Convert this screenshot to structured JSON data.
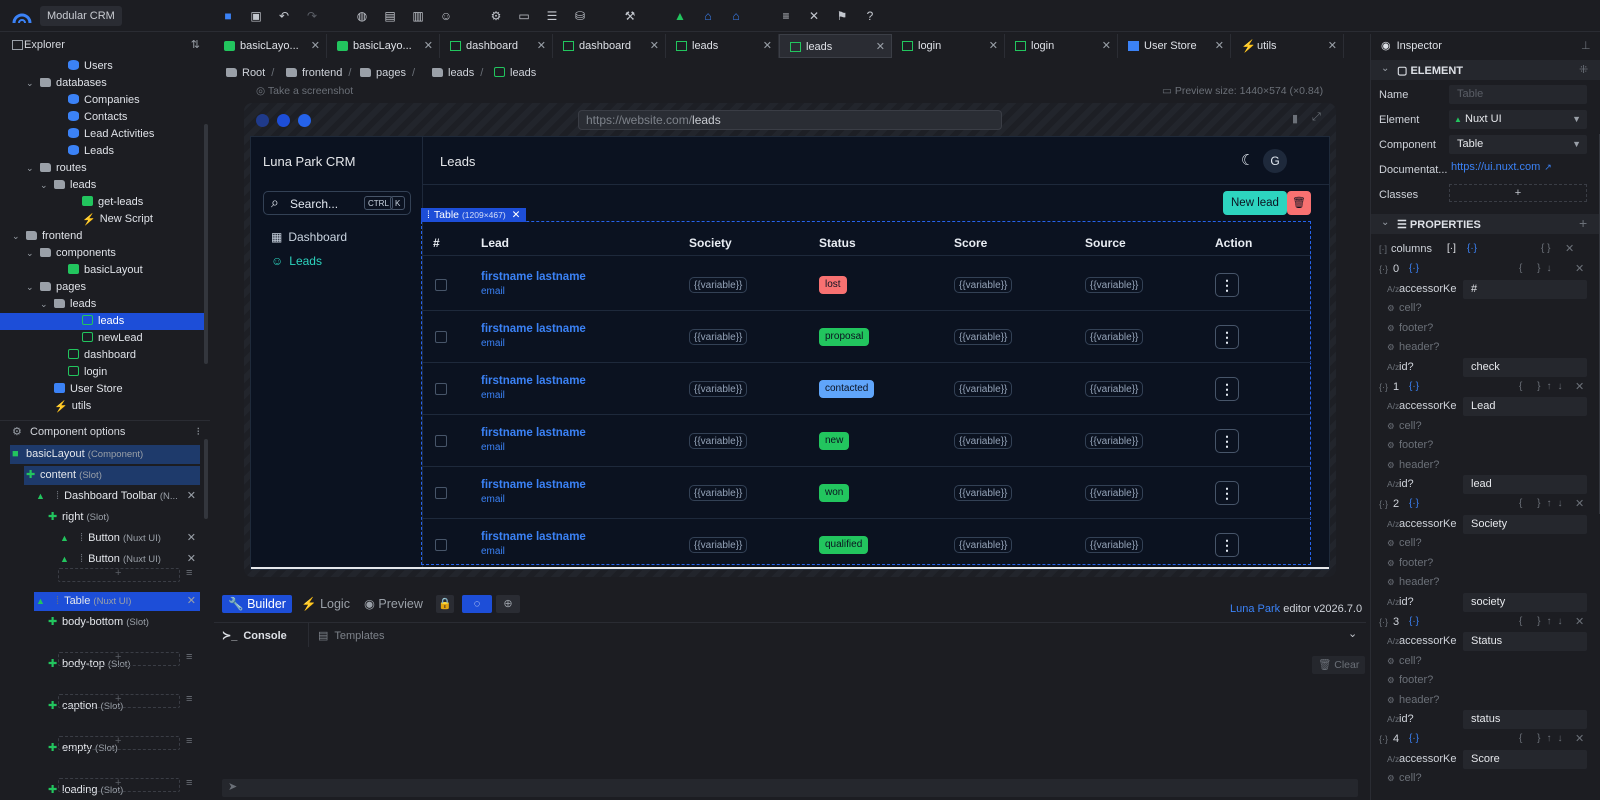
{
  "app": {
    "name": "Modular CRM"
  },
  "explorer": {
    "title": "Explorer",
    "tree": [
      {
        "label": "Users",
        "icon": "db"
      },
      {
        "label": "databases",
        "icon": "folder"
      },
      {
        "label": "Companies",
        "icon": "db"
      },
      {
        "label": "Contacts",
        "icon": "db"
      },
      {
        "label": "Lead Activities",
        "icon": "db"
      },
      {
        "label": "Leads",
        "icon": "db"
      },
      {
        "label": "routes",
        "icon": "folder"
      },
      {
        "label": "leads",
        "icon": "folder"
      },
      {
        "label": "get-leads",
        "icon": "comp"
      },
      {
        "label": "New Script",
        "icon": "bolt"
      },
      {
        "label": "frontend",
        "icon": "folder"
      },
      {
        "label": "components",
        "icon": "folder"
      },
      {
        "label": "basicLayout",
        "icon": "comp"
      },
      {
        "label": "pages",
        "icon": "folder"
      },
      {
        "label": "leads",
        "icon": "folder"
      },
      {
        "label": "leads",
        "icon": "page"
      },
      {
        "label": "newLead",
        "icon": "page"
      },
      {
        "label": "dashboard",
        "icon": "page"
      },
      {
        "label": "login",
        "icon": "page"
      },
      {
        "label": "User Store",
        "icon": "store"
      },
      {
        "label": "utils",
        "icon": "bolt"
      }
    ]
  },
  "tabs": [
    "basicLayo...",
    "basicLayo...",
    "dashboard",
    "dashboard",
    "leads",
    "leads",
    "login",
    "login",
    "User Store",
    "utils"
  ],
  "breadcrumb": [
    "Root",
    "frontend",
    "pages",
    "leads",
    "leads"
  ],
  "toolbar_hint": {
    "screenshot": "Take a screenshot",
    "preview_size": "Preview size: 1440×574 (×0.84)"
  },
  "browser": {
    "url_host": "https://website.com/",
    "url_path": "leads"
  },
  "crm": {
    "brand": "Luna Park CRM",
    "search": "Search...",
    "kbd1": "CTRL",
    "kbd2": "K",
    "nav": [
      "Dashboard",
      "Leads"
    ],
    "header": "Leads",
    "avatar": "G",
    "new_lead": "New lead",
    "table_tag": "Table",
    "table_size": "(1209×467)",
    "columns": [
      "#",
      "Lead",
      "Society",
      "Status",
      "Score",
      "Source",
      "Action"
    ],
    "rows": [
      {
        "name": "firstname lastname",
        "email": "email",
        "status": "lost",
        "status_color": "#f87171"
      },
      {
        "name": "firstname lastname",
        "email": "email",
        "status": "proposal",
        "status_color": "#22c55e"
      },
      {
        "name": "firstname lastname",
        "email": "email",
        "status": "contacted",
        "status_color": "#60a5fa"
      },
      {
        "name": "firstname lastname",
        "email": "email",
        "status": "new",
        "status_color": "#22c55e"
      },
      {
        "name": "firstname lastname",
        "email": "email",
        "status": "won",
        "status_color": "#22c55e"
      },
      {
        "name": "firstname lastname",
        "email": "email",
        "status": "qualified",
        "status_color": "#22c55e"
      }
    ],
    "variable": "{{variable}}"
  },
  "component_options": {
    "title": "Component options",
    "items": [
      {
        "label": "basicLayout",
        "suffix": "(Component)"
      },
      {
        "label": "content",
        "suffix": "(Slot)"
      },
      {
        "label": "Dashboard Toolbar",
        "suffix": "(N..."
      },
      {
        "label": "right",
        "suffix": "(Slot)"
      },
      {
        "label": "Button",
        "suffix": "(Nuxt UI)"
      },
      {
        "label": "Button",
        "suffix": "(Nuxt UI)"
      },
      {
        "label": "Table",
        "suffix": "(Nuxt UI)"
      },
      {
        "label": "body-bottom",
        "suffix": "(Slot)"
      },
      {
        "label": "body-top",
        "suffix": "(Slot)"
      },
      {
        "label": "caption",
        "suffix": "(Slot)"
      },
      {
        "label": "empty",
        "suffix": "(Slot)"
      },
      {
        "label": "loading",
        "suffix": "(Slot)"
      }
    ]
  },
  "bottom": {
    "modes": [
      "Builder",
      "Logic",
      "Preview"
    ],
    "console": "Console",
    "templates": "Templates",
    "clear": "Clear",
    "brand": "Luna Park",
    "version": "editor v2026.7.0"
  },
  "inspector": {
    "title": "Inspector",
    "element_section": "ELEMENT",
    "name_label": "Name",
    "name_placeholder": "Table",
    "element_label": "Element",
    "element_value": "Nuxt UI",
    "component_label": "Component",
    "component_value": "Table",
    "doc_label": "Documentat...",
    "doc_value": "https://ui.nuxt.com",
    "classes_label": "Classes",
    "properties_section": "PROPERTIES",
    "columns_label": "columns",
    "entries": [
      {
        "index": "0",
        "accessor": "#",
        "id": "check"
      },
      {
        "index": "1",
        "accessor": "Lead",
        "id": "lead"
      },
      {
        "index": "2",
        "accessor": "Society",
        "id": "society"
      },
      {
        "index": "3",
        "accessor": "Status",
        "id": "status"
      },
      {
        "index": "4",
        "accessor": "Score",
        "id": ""
      }
    ],
    "accessor_label": "accessorKe",
    "cell": "cell?",
    "footer": "footer?",
    "header": "header?",
    "id_label": "id?"
  }
}
